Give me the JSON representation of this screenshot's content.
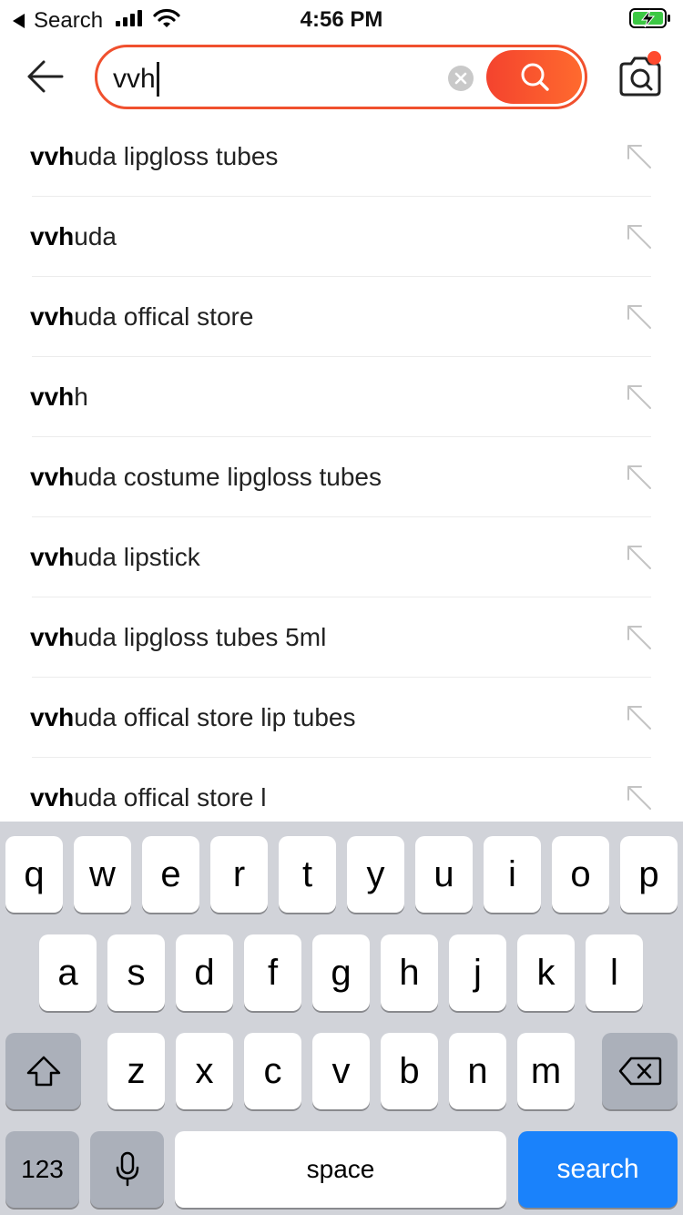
{
  "status_bar": {
    "back_label": "Search",
    "time": "4:56 PM",
    "battery_state": "charging",
    "battery_color": "#3cc844"
  },
  "header": {
    "back_icon": "back-arrow-icon",
    "search_value": "vvh",
    "clear_icon": "clear-icon",
    "search_icon": "search-icon",
    "camera_icon": "camera-icon",
    "accent_color": "#f0502e"
  },
  "suggestions": [
    {
      "match": "vvh",
      "rest": "uda lipgloss tubes"
    },
    {
      "match": "vvh",
      "rest": "uda"
    },
    {
      "match": "vvh",
      "rest": "uda offical store"
    },
    {
      "match": "vvh",
      "rest": "h"
    },
    {
      "match": "vvh",
      "rest": "uda costume lipgloss tubes"
    },
    {
      "match": "vvh",
      "rest": "uda lipstick"
    },
    {
      "match": "vvh",
      "rest": "uda lipgloss tubes 5ml"
    },
    {
      "match": "vvh",
      "rest": "uda offical store lip tubes"
    },
    {
      "match": "vvh",
      "rest": "uda offical store l"
    }
  ],
  "keyboard": {
    "row1": [
      "q",
      "w",
      "e",
      "r",
      "t",
      "y",
      "u",
      "i",
      "o",
      "p"
    ],
    "row2": [
      "a",
      "s",
      "d",
      "f",
      "g",
      "h",
      "j",
      "k",
      "l"
    ],
    "row3": [
      "z",
      "x",
      "c",
      "v",
      "b",
      "n",
      "m"
    ],
    "numbers_label": "123",
    "space_label": "space",
    "search_label": "search",
    "shift_icon": "shift-icon",
    "delete_icon": "delete-icon",
    "mic_icon": "microphone-icon"
  }
}
